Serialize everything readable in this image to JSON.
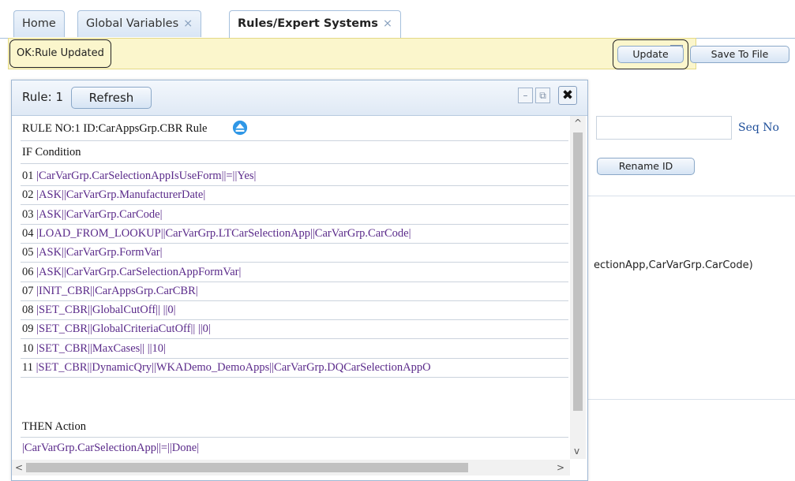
{
  "tabs": [
    {
      "label": "Home",
      "closable": false
    },
    {
      "label": "Global Variables",
      "closable": true
    },
    {
      "label": "Rules/Expert Systems",
      "closable": true,
      "active": true
    }
  ],
  "tab_close_glyph": "×",
  "status": {
    "message": "OK:Rule Updated",
    "close_glyph": "x"
  },
  "toolbar": {
    "update_label": "Update",
    "save_to_file_label": "Save To File"
  },
  "background": {
    "seq_label": "Seq No",
    "rename_id_label": "Rename ID",
    "lookup_text": "ectionApp,CarVarGrp.CarCode)"
  },
  "dialog": {
    "title": "Rule: 1",
    "refresh_label": "Refresh",
    "rule_header": "RULE NO:1 ID:CarAppsGrp.CBR Rule",
    "if_label": "IF Condition",
    "then_label": "THEN Action",
    "conditions": [
      {
        "num": "01",
        "text": "|CarVarGrp.CarSelectionAppIsUseForm||=||Yes|"
      },
      {
        "num": "02",
        "text": "|ASK||CarVarGrp.ManufacturerDate|"
      },
      {
        "num": "03",
        "text": "|ASK||CarVarGrp.CarCode|"
      },
      {
        "num": "04",
        "text": "|LOAD_FROM_LOOKUP||CarVarGrp.LTCarSelectionApp||CarVarGrp.CarCode|"
      },
      {
        "num": "05",
        "text": "|ASK||CarVarGrp.FormVar|"
      },
      {
        "num": "06",
        "text": "|ASK||CarVarGrp.CarSelectionAppFormVar|"
      },
      {
        "num": "07",
        "text": "|INIT_CBR||CarAppsGrp.CarCBR|"
      },
      {
        "num": "08",
        "text": "|SET_CBR||GlobalCutOff|| ||0|"
      },
      {
        "num": "09",
        "text": "|SET_CBR||GlobalCriteriaCutOff|| ||0|"
      },
      {
        "num": "10",
        "text": "|SET_CBR||MaxCases|| ||10|"
      },
      {
        "num": "11",
        "text": "|SET_CBR||DynamicQry||WKADemo_DemoApps||CarVarGrp.DQCarSelectionAppO"
      }
    ],
    "action": "|CarVarGrp.CarSelectionApp||=||Done|"
  }
}
